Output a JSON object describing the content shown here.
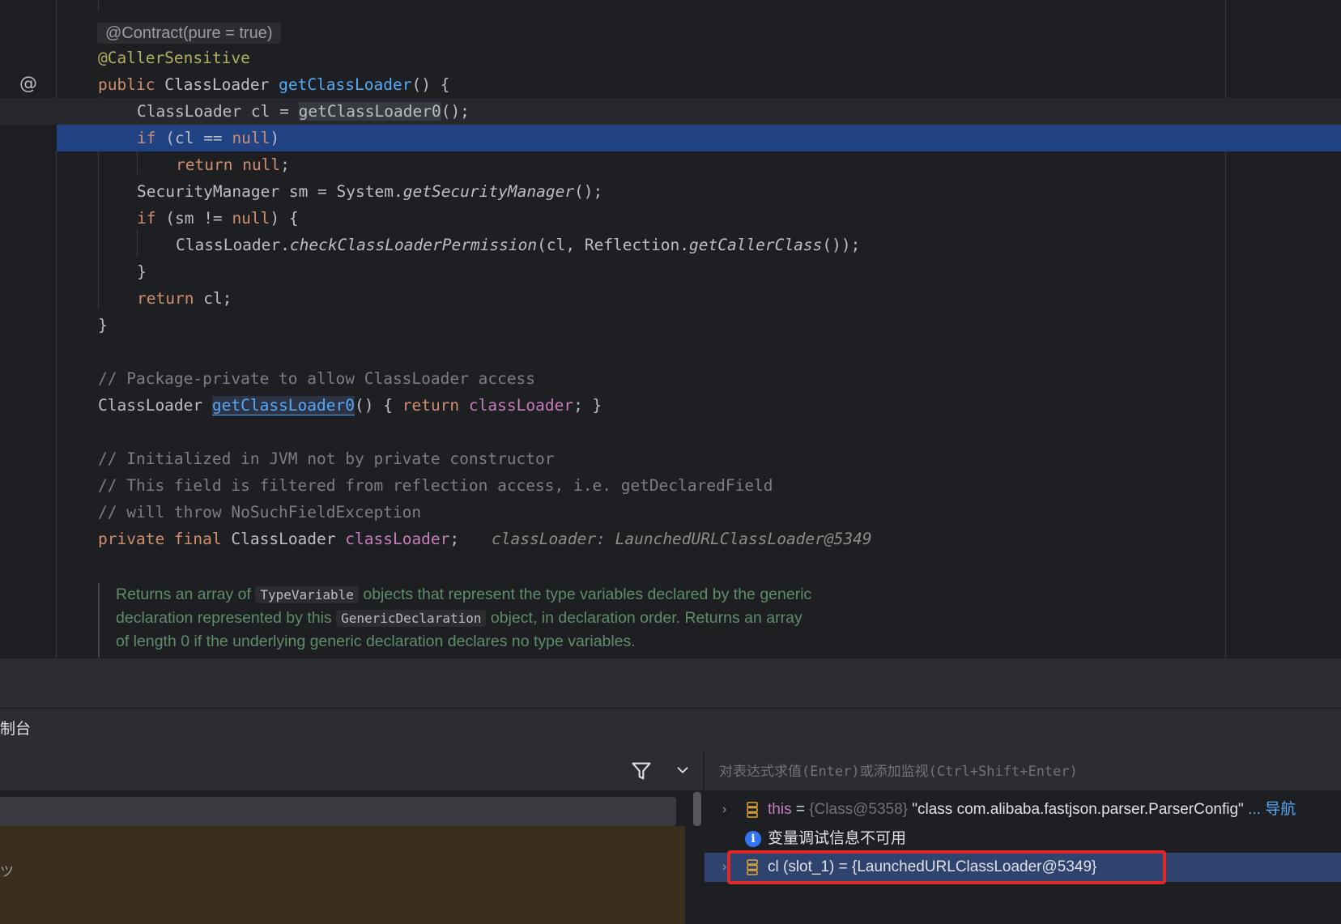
{
  "editor": {
    "contract_hint": "@Contract(pure = true)",
    "caller_sensitive": "@CallerSensitive",
    "l_public": "public",
    "l_classloader": "ClassLoader",
    "l_getclassloader": "getClassLoader",
    "l_paren_brace": "() {",
    "l_cl_decl": "ClassLoader cl =",
    "l_getclassloader0": "getClassLoader0",
    "l_call_end": "();",
    "l_if": "if",
    "l_cl_eq": "(cl ==",
    "l_null": "null",
    "l_close_paren": ")",
    "l_return": "return",
    "l_semicolon": ";",
    "l_sm_decl": "SecurityManager sm = System.",
    "l_getsecuritymanager": "getSecurityManager",
    "l_sm_neq": "(sm !=",
    "l_close_brace_open": ") {",
    "l_classloader_dot": "ClassLoader.",
    "l_checkperm": "checkClassLoaderPermission",
    "l_cl_reflection": "(cl, Reflection.",
    "l_getcallerclass": "getCallerClass",
    "l_call_end2": "());",
    "l_close": "}",
    "l_return_cl": "cl;",
    "comment_package_private": "// Package-private to allow ClassLoader access",
    "l_brace_return": "() {",
    "l_field": "classLoader",
    "l_end_method": "; }",
    "comment_jvm": "// Initialized in JVM not by private constructor",
    "comment_filtered": "// This field is filtered from reflection access, i.e. getDeclaredField",
    "comment_throw": "// will throw NoSuchFieldException",
    "l_private_final": "private final",
    "inlay_hint": "classLoader: LaunchedURLClassLoader@5349",
    "doc_line1_a": "Returns an array of",
    "doc_code1": "TypeVariable",
    "doc_line1_b": "objects that represent the type variables declared by the generic",
    "doc_line2_a": "declaration represented by this",
    "doc_code2": "GenericDeclaration",
    "doc_line2_b": "object, in declaration order. Returns an array",
    "doc_line3": "of length 0 if the underlying generic declaration declares no type variables."
  },
  "toolwindow": {
    "console_tab": "制台"
  },
  "frames": {
    "thread_glyph": "ツ"
  },
  "evaluate": {
    "placeholder": "对表达式求值(Enter)或添加监视(Ctrl+Shift+Enter)"
  },
  "variables": {
    "this_name": "this",
    "this_eq": " = ",
    "this_type": "{Class@5358}",
    "this_value": " \"class com.alibaba.fastjson.parser.ParserConfig\"",
    "this_more": " ... 导航",
    "info_text": "变量调试信息不可用",
    "cl_text": "cl (slot_1) = {LaunchedURLClassLoader@5349}"
  },
  "colors": {
    "exec_line": "#214283",
    "selection_box": "#e02828",
    "keyword": "#cf8e6d",
    "function": "#56a8f5"
  }
}
